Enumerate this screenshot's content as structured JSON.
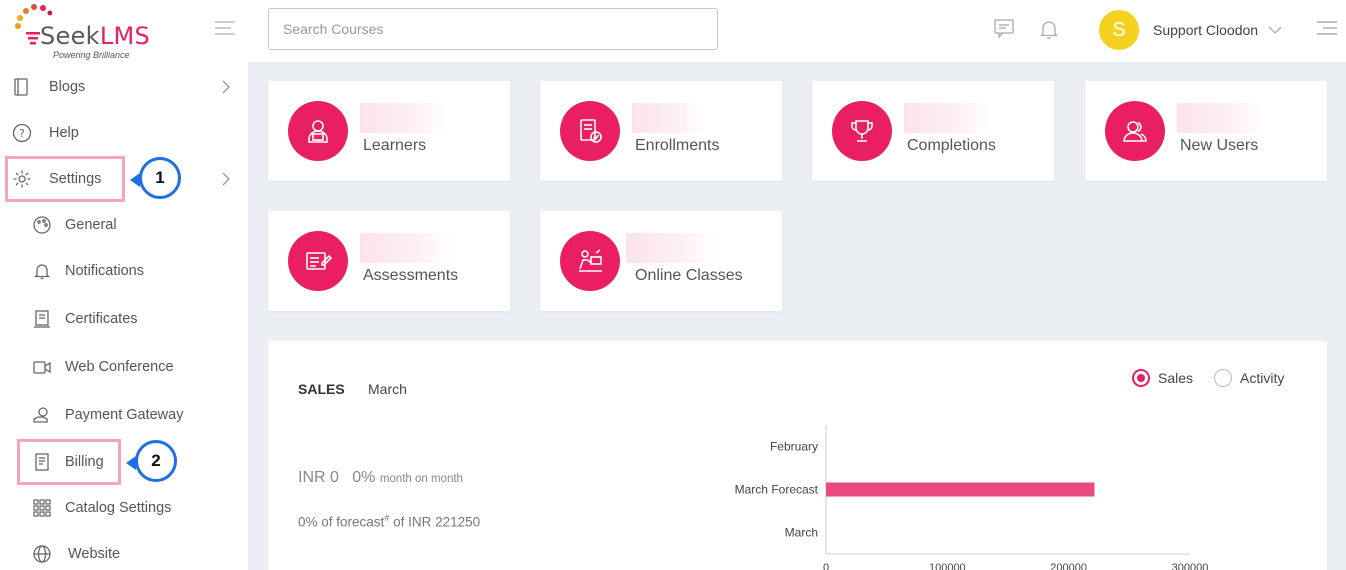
{
  "brand": {
    "name_a": "Seek",
    "name_b": "LMS",
    "tagline": "Powering Brilliance"
  },
  "header": {
    "search_placeholder": "Search Courses",
    "user_name": "Support Cloodon",
    "avatar_letter": "S"
  },
  "sidebar": {
    "items": [
      {
        "label": "Blogs",
        "icon": "book-icon"
      },
      {
        "label": "Help",
        "icon": "help-icon"
      },
      {
        "label": "Settings",
        "icon": "gear-icon"
      },
      {
        "label": "General",
        "icon": "palette-icon"
      },
      {
        "label": "Notifications",
        "icon": "bell-icon"
      },
      {
        "label": "Certificates",
        "icon": "certificate-icon"
      },
      {
        "label": "Web Conference",
        "icon": "video-icon"
      },
      {
        "label": "Payment Gateway",
        "icon": "payment-icon"
      },
      {
        "label": "Billing",
        "icon": "billing-icon"
      },
      {
        "label": "Catalog Settings",
        "icon": "grid-icon"
      },
      {
        "label": "Website",
        "icon": "globe-icon"
      }
    ]
  },
  "callouts": [
    "1",
    "2"
  ],
  "cards": [
    {
      "label": "Learners",
      "icon": "learner-icon"
    },
    {
      "label": "Enrollments",
      "icon": "enrollment-icon"
    },
    {
      "label": "Completions",
      "icon": "trophy-icon"
    },
    {
      "label": "New Users",
      "icon": "users-icon"
    },
    {
      "label": "Assessments",
      "icon": "assessment-icon"
    },
    {
      "label": "Online Classes",
      "icon": "online-class-icon"
    }
  ],
  "sales": {
    "tab_sales": "SALES",
    "tab_month": "March",
    "radio_sales": "Sales",
    "radio_activity": "Activity",
    "amount": "INR 0",
    "change": "0%",
    "change_note": "month on month",
    "forecast_prefix": "0% of forecast",
    "forecast_sup": "#",
    "forecast_suffix": " of INR 221250"
  },
  "colors": {
    "accent": "#e91e63",
    "callout": "#1e6ee8",
    "highlight": "#f4a4c0"
  },
  "chart_data": {
    "type": "bar",
    "orientation": "horizontal",
    "categories": [
      "February",
      "March Forecast",
      "March"
    ],
    "values": [
      0,
      221250,
      0
    ],
    "xlim": [
      0,
      300000
    ],
    "xticks": [
      "0",
      "100000",
      "200000",
      "300000"
    ],
    "color": "#e84a7f"
  }
}
